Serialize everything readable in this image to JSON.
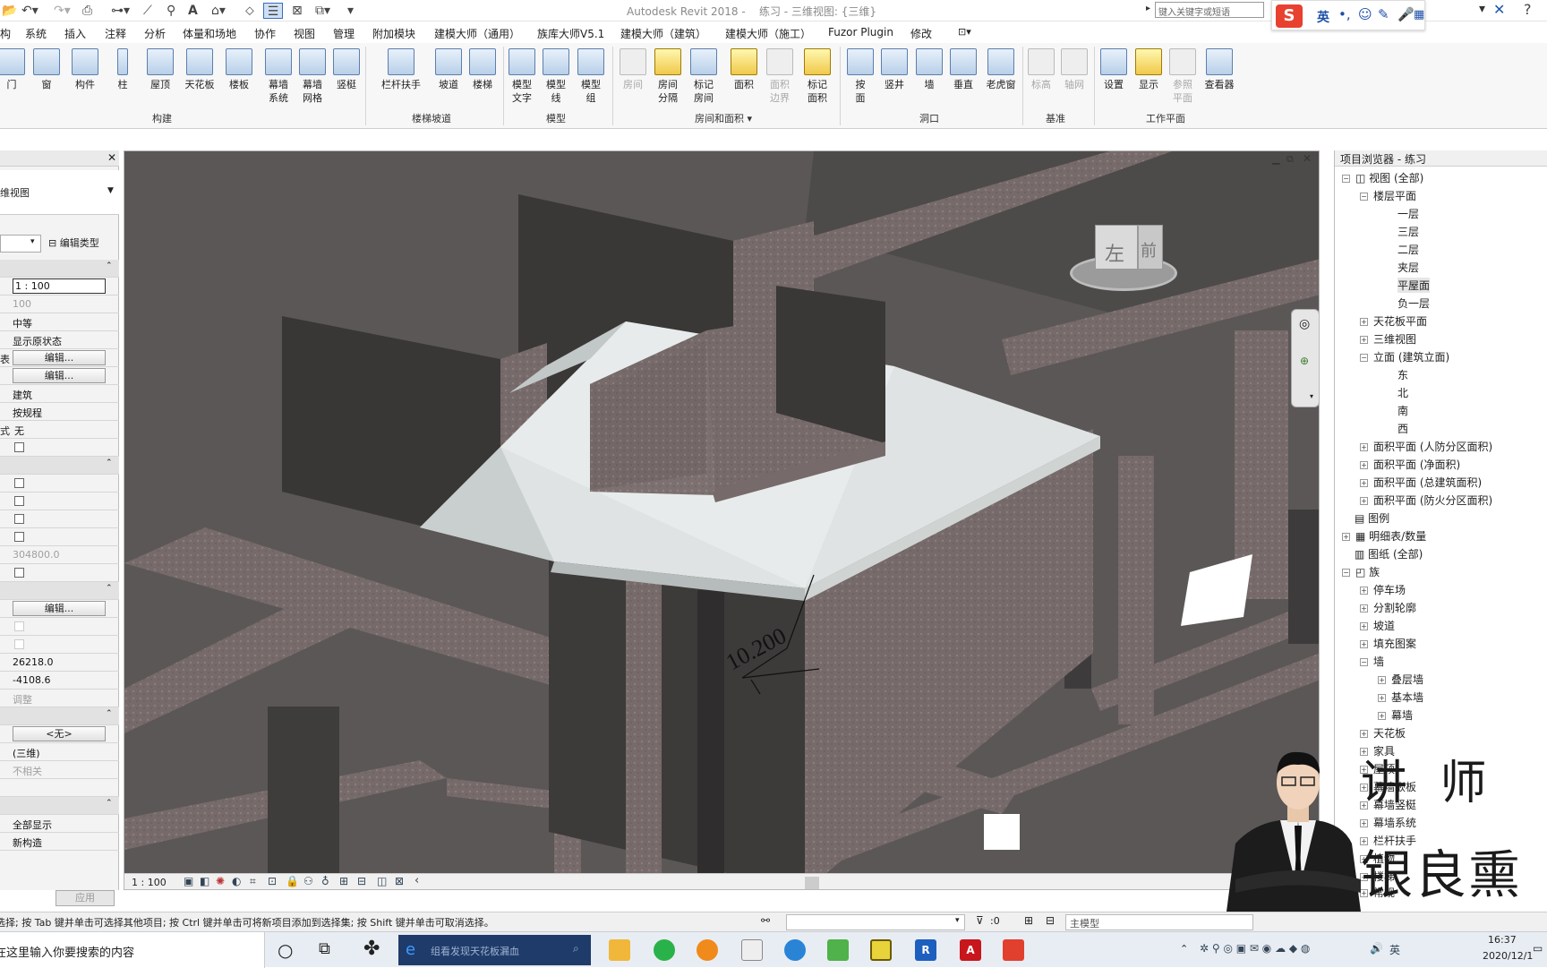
{
  "app": {
    "title": "Autodesk Revit 2018 -",
    "document": "练习 - 三维视图: {三维}"
  },
  "search": {
    "placeholder": "键入关键字或短语"
  },
  "ime": {
    "lang": "英"
  },
  "menu": [
    "构",
    "系统",
    "插入",
    "注释",
    "分析",
    "体量和场地",
    "协作",
    "视图",
    "管理",
    "附加模块",
    "建模大师（通用）",
    "族库大师V5.1",
    "建模大师（建筑）",
    "建模大师（施工）",
    "Fuzor Plugin",
    "修改"
  ],
  "ribbon": {
    "buttons": [
      {
        "l1": "门",
        "l2": ""
      },
      {
        "l1": "窗",
        "l2": ""
      },
      {
        "l1": "构件",
        "l2": ""
      },
      {
        "l1": "柱",
        "l2": ""
      },
      {
        "l1": "屋顶",
        "l2": ""
      },
      {
        "l1": "天花板",
        "l2": ""
      },
      {
        "l1": "楼板",
        "l2": ""
      },
      {
        "l1": "幕墙",
        "l2": "系统"
      },
      {
        "l1": "幕墙",
        "l2": "网格"
      },
      {
        "l1": "竖梃",
        "l2": ""
      },
      {
        "l1": "栏杆扶手",
        "l2": ""
      },
      {
        "l1": "坡道",
        "l2": ""
      },
      {
        "l1": "楼梯",
        "l2": ""
      },
      {
        "l1": "模型",
        "l2": "文字"
      },
      {
        "l1": "模型",
        "l2": "线"
      },
      {
        "l1": "模型",
        "l2": "组"
      },
      {
        "l1": "房间",
        "l2": ""
      },
      {
        "l1": "房间",
        "l2": "分隔"
      },
      {
        "l1": "标记",
        "l2": "房间"
      },
      {
        "l1": "面积",
        "l2": ""
      },
      {
        "l1": "面积",
        "l2": "边界"
      },
      {
        "l1": "标记",
        "l2": "面积"
      },
      {
        "l1": "按",
        "l2": "面"
      },
      {
        "l1": "竖井",
        "l2": ""
      },
      {
        "l1": "墙",
        "l2": ""
      },
      {
        "l1": "垂直",
        "l2": ""
      },
      {
        "l1": "老虎窗",
        "l2": ""
      },
      {
        "l1": "标高",
        "l2": ""
      },
      {
        "l1": "轴网",
        "l2": ""
      },
      {
        "l1": "设置",
        "l2": ""
      },
      {
        "l1": "显示",
        "l2": ""
      },
      {
        "l1": "参照",
        "l2": "平面"
      },
      {
        "l1": "查看器",
        "l2": ""
      }
    ],
    "groups": [
      "构建",
      "楼梯坡道",
      "模型",
      "房间和面积",
      "洞口",
      "基准",
      "工作平面"
    ]
  },
  "properties": {
    "type_label": "维视图",
    "edit_type": "编辑类型",
    "rows": [
      {
        "key": "",
        "value": "1 : 100"
      },
      {
        "key": "",
        "value": "100"
      },
      {
        "key": "",
        "value": "中等"
      },
      {
        "key": "",
        "value": "显示原状态"
      },
      {
        "key": "表",
        "value": "编辑..."
      },
      {
        "key": "",
        "value": "编辑..."
      },
      {
        "key": "",
        "value": "建筑"
      },
      {
        "key": "",
        "value": "按规程"
      },
      {
        "key": "式",
        "value": "无"
      },
      {
        "key": "",
        "value": ""
      },
      {
        "key": "",
        "value": ""
      },
      {
        "key": "",
        "value": ""
      },
      {
        "key": "",
        "value": ""
      },
      {
        "key": "",
        "value": ""
      },
      {
        "key": "",
        "value": "304800.0"
      },
      {
        "key": "",
        "value": ""
      },
      {
        "key": "",
        "value": "编辑..."
      },
      {
        "key": "",
        "value": "26218.0"
      },
      {
        "key": "",
        "value": "-4108.6"
      },
      {
        "key": "",
        "value": "调整"
      },
      {
        "key": "",
        "value": "<无>"
      },
      {
        "key": "",
        "value": "(三维)"
      },
      {
        "key": "",
        "value": "不相关"
      },
      {
        "key": "",
        "value": "全部显示"
      },
      {
        "key": "",
        "value": "新构造"
      }
    ],
    "apply": "应用"
  },
  "viewport": {
    "dimension": "10.200",
    "viewcube_left": "左",
    "viewcube_front": "前",
    "scale": "1 : 100"
  },
  "browser": {
    "title": "项目浏览器 - 练习",
    "nodes": [
      "视图 (全部)",
      "楼层平面",
      "一层",
      "三层",
      "二层",
      "夹层",
      "平屋面",
      "负一层",
      "天花板平面",
      "三维视图",
      "立面 (建筑立面)",
      "东",
      "北",
      "南",
      "西",
      "面积平面 (人防分区面积)",
      "面积平面 (净面积)",
      "面积平面 (总建筑面积)",
      "面积平面 (防火分区面积)",
      "图例",
      "明细表/数量",
      "图纸 (全部)",
      "族",
      "停车场",
      "分割轮廓",
      "坡道",
      "填充图案",
      "墙",
      "叠层墙",
      "基本墙",
      "幕墙",
      "天花板",
      "家具",
      "屋顶",
      "幕墙嵌板",
      "幕墙竖梃",
      "幕墙系统",
      "栏杆扶手",
      "植物",
      "楼梯",
      "常规"
    ]
  },
  "status": {
    "hint": "单击可进行选择; 按 Tab 键并单击可选择其他项目; 按 Ctrl 键并单击可将新项目添加到选择集; 按 Shift 键并单击可取消选择。",
    "sel_count": ":0",
    "model": "主模型"
  },
  "taskbar": {
    "search": "在这里输入你要搜索的内容",
    "browser_text": "组看发现天花板漏血",
    "time": "16:37",
    "date": "2020/12/1"
  },
  "presenter": {
    "title": "讲 师",
    "name": "银良熏"
  }
}
